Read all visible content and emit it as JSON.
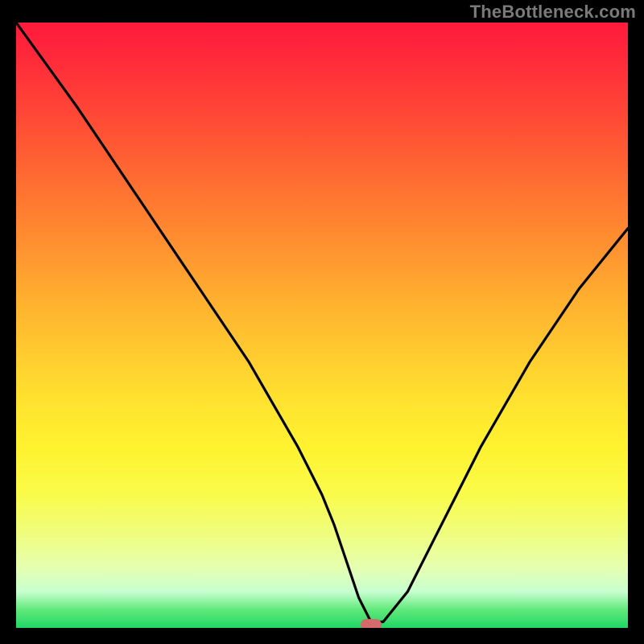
{
  "watermark": "TheBottleneck.com",
  "colors": {
    "frame_bg": "#000000",
    "curve_stroke": "#000000",
    "marker": "#d46a6a",
    "watermark_text": "#7a7a7a",
    "gradient_top": "#ff1a3c",
    "gradient_bottom": "#1fd766"
  },
  "chart_data": {
    "type": "line",
    "title": "",
    "xlabel": "",
    "ylabel": "",
    "xlim": [
      0,
      100
    ],
    "ylim": [
      0,
      100
    ],
    "grid": false,
    "legend": false,
    "series": [
      {
        "name": "bottleneck-curve",
        "x": [
          0,
          5,
          10,
          14,
          18,
          22,
          26,
          30,
          34,
          38,
          42,
          46,
          50,
          52,
          54,
          56,
          58,
          60,
          64,
          68,
          72,
          76,
          80,
          84,
          88,
          92,
          96,
          100
        ],
        "y": [
          100,
          93,
          86,
          80,
          74,
          68,
          62,
          56,
          50,
          44,
          37,
          30,
          22,
          17,
          11,
          5,
          1,
          1,
          6,
          14,
          22,
          30,
          37,
          44,
          50,
          56,
          61,
          66
        ]
      }
    ],
    "annotations": [
      {
        "name": "optimal-marker",
        "x": 58,
        "y": 0.5
      }
    ],
    "background_gradient": {
      "orientation": "vertical",
      "stops": [
        {
          "pos": 0.0,
          "color": "#ff1a3c"
        },
        {
          "pos": 0.5,
          "color": "#ffc92f"
        },
        {
          "pos": 0.8,
          "color": "#f0fd7a"
        },
        {
          "pos": 1.0,
          "color": "#1fd766"
        }
      ]
    }
  }
}
